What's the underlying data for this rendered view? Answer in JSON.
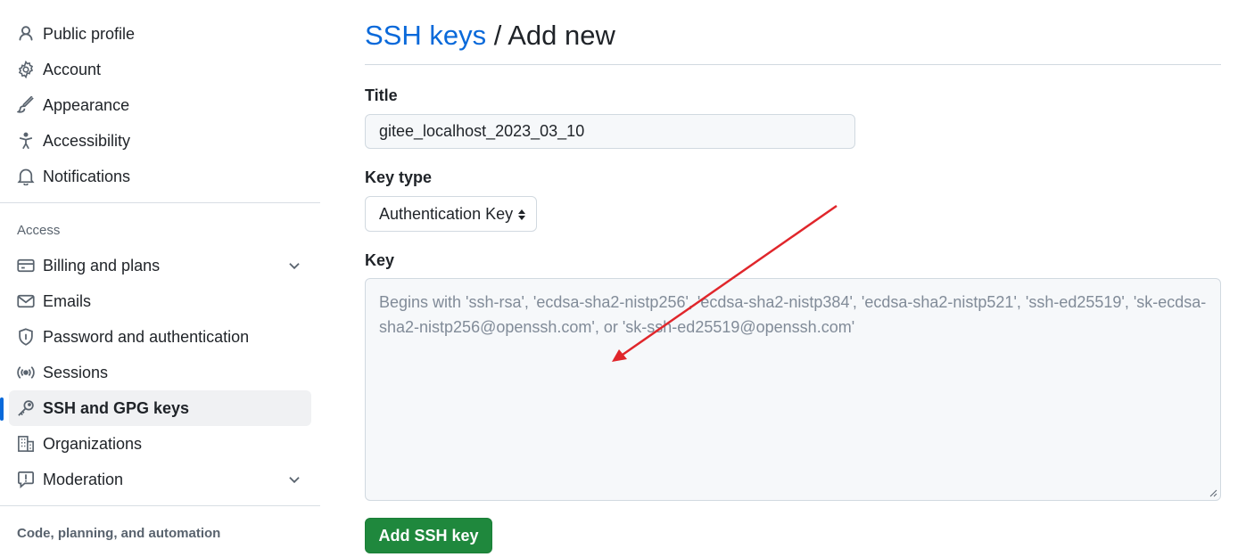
{
  "sidebar": {
    "items_top": [
      {
        "label": "Public profile",
        "icon": "person-icon"
      },
      {
        "label": "Account",
        "icon": "gear-icon"
      },
      {
        "label": "Appearance",
        "icon": "paintbrush-icon"
      },
      {
        "label": "Accessibility",
        "icon": "accessibility-icon"
      },
      {
        "label": "Notifications",
        "icon": "bell-icon"
      }
    ],
    "access_label": "Access",
    "items_access": [
      {
        "label": "Billing and plans",
        "icon": "credit-card-icon",
        "expandable": true
      },
      {
        "label": "Emails",
        "icon": "mail-icon"
      },
      {
        "label": "Password and authentication",
        "icon": "shield-lock-icon"
      },
      {
        "label": "Sessions",
        "icon": "broadcast-icon"
      },
      {
        "label": "SSH and GPG keys",
        "icon": "key-icon",
        "active": true
      },
      {
        "label": "Organizations",
        "icon": "organization-icon"
      },
      {
        "label": "Moderation",
        "icon": "report-icon",
        "expandable": true
      }
    ],
    "code_label": "Code, planning, and automation"
  },
  "main": {
    "breadcrumb_link": "SSH keys",
    "breadcrumb_sep": " / ",
    "page_title": "Add new",
    "title_label": "Title",
    "title_value": "gitee_localhost_2023_03_10",
    "key_type_label": "Key type",
    "key_type_value": "Authentication Key",
    "key_label": "Key",
    "key_placeholder_line1": "Begins with 'ssh-rsa', 'ecdsa-sha2-nistp256', 'ecdsa-sha2-nistp384', 'ecdsa-sha2-nistp521', 'ssh-ed25519', 'sk-ecdsa-",
    "key_placeholder_line2": "sha2-nistp256@openssh.com', or 'sk-ssh-ed25519@openssh.com'",
    "submit_label": "Add SSH key"
  },
  "colors": {
    "link": "#0969da",
    "primary_button": "#1f883d",
    "active_indicator": "#0969da",
    "annotation_arrow": "#e0262b"
  }
}
